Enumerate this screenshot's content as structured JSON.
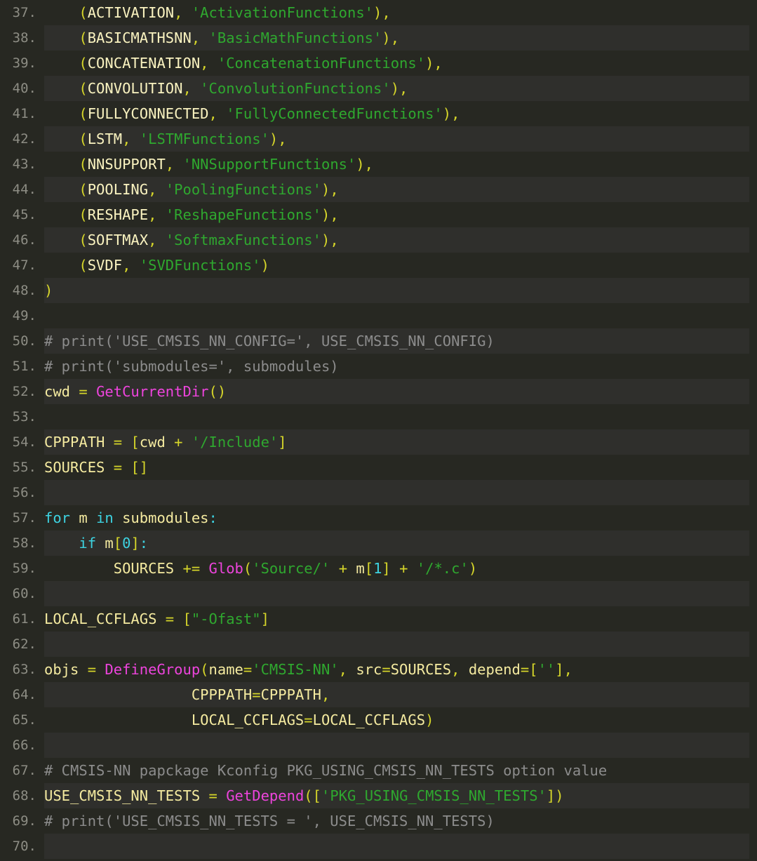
{
  "editor": {
    "name": "code-viewer",
    "language": "python",
    "background_color": "#272822",
    "alt_row_color": "#2f2f2c",
    "gutter_color": "#8d8d84",
    "first_line_number": 37,
    "last_line_number": 70,
    "colors": {
      "string": "#2fa82f",
      "comment": "#8c8c8c",
      "function": "#ee44dd",
      "keyword": "#3dd2e0",
      "number": "#3dd2e0",
      "identifier": "#f5eba0",
      "punctuation": "#d6d62a",
      "operator": "#d6d62a",
      "constant": "#faf3c0",
      "foreground": "#f8f8f2"
    }
  },
  "lines": [
    {
      "n": "37.",
      "alt": false,
      "tokens": [
        {
          "t": "    ",
          "c": "t-plain"
        },
        {
          "t": "(",
          "c": "t-punct"
        },
        {
          "t": "ACTIVATION",
          "c": "t-const"
        },
        {
          "t": ",",
          "c": "t-punct"
        },
        {
          "t": " ",
          "c": "t-plain"
        },
        {
          "t": "'ActivationFunctions'",
          "c": "t-string"
        },
        {
          "t": "),",
          "c": "t-punct"
        }
      ]
    },
    {
      "n": "38.",
      "alt": true,
      "tokens": [
        {
          "t": "    ",
          "c": "t-plain"
        },
        {
          "t": "(",
          "c": "t-punct"
        },
        {
          "t": "BASICMATHSNN",
          "c": "t-const"
        },
        {
          "t": ",",
          "c": "t-punct"
        },
        {
          "t": " ",
          "c": "t-plain"
        },
        {
          "t": "'BasicMathFunctions'",
          "c": "t-string"
        },
        {
          "t": "),",
          "c": "t-punct"
        }
      ]
    },
    {
      "n": "39.",
      "alt": false,
      "tokens": [
        {
          "t": "    ",
          "c": "t-plain"
        },
        {
          "t": "(",
          "c": "t-punct"
        },
        {
          "t": "CONCATENATION",
          "c": "t-const"
        },
        {
          "t": ",",
          "c": "t-punct"
        },
        {
          "t": " ",
          "c": "t-plain"
        },
        {
          "t": "'ConcatenationFunctions'",
          "c": "t-string"
        },
        {
          "t": "),",
          "c": "t-punct"
        }
      ]
    },
    {
      "n": "40.",
      "alt": true,
      "tokens": [
        {
          "t": "    ",
          "c": "t-plain"
        },
        {
          "t": "(",
          "c": "t-punct"
        },
        {
          "t": "CONVOLUTION",
          "c": "t-const"
        },
        {
          "t": ",",
          "c": "t-punct"
        },
        {
          "t": " ",
          "c": "t-plain"
        },
        {
          "t": "'ConvolutionFunctions'",
          "c": "t-string"
        },
        {
          "t": "),",
          "c": "t-punct"
        }
      ]
    },
    {
      "n": "41.",
      "alt": false,
      "tokens": [
        {
          "t": "    ",
          "c": "t-plain"
        },
        {
          "t": "(",
          "c": "t-punct"
        },
        {
          "t": "FULLYCONNECTED",
          "c": "t-const"
        },
        {
          "t": ",",
          "c": "t-punct"
        },
        {
          "t": " ",
          "c": "t-plain"
        },
        {
          "t": "'FullyConnectedFunctions'",
          "c": "t-string"
        },
        {
          "t": "),",
          "c": "t-punct"
        }
      ]
    },
    {
      "n": "42.",
      "alt": true,
      "tokens": [
        {
          "t": "    ",
          "c": "t-plain"
        },
        {
          "t": "(",
          "c": "t-punct"
        },
        {
          "t": "LSTM",
          "c": "t-const"
        },
        {
          "t": ",",
          "c": "t-punct"
        },
        {
          "t": " ",
          "c": "t-plain"
        },
        {
          "t": "'LSTMFunctions'",
          "c": "t-string"
        },
        {
          "t": "),",
          "c": "t-punct"
        }
      ]
    },
    {
      "n": "43.",
      "alt": false,
      "tokens": [
        {
          "t": "    ",
          "c": "t-plain"
        },
        {
          "t": "(",
          "c": "t-punct"
        },
        {
          "t": "NNSUPPORT",
          "c": "t-const"
        },
        {
          "t": ",",
          "c": "t-punct"
        },
        {
          "t": " ",
          "c": "t-plain"
        },
        {
          "t": "'NNSupportFunctions'",
          "c": "t-string"
        },
        {
          "t": "),",
          "c": "t-punct"
        }
      ]
    },
    {
      "n": "44.",
      "alt": true,
      "tokens": [
        {
          "t": "    ",
          "c": "t-plain"
        },
        {
          "t": "(",
          "c": "t-punct"
        },
        {
          "t": "POOLING",
          "c": "t-const"
        },
        {
          "t": ",",
          "c": "t-punct"
        },
        {
          "t": " ",
          "c": "t-plain"
        },
        {
          "t": "'PoolingFunctions'",
          "c": "t-string"
        },
        {
          "t": "),",
          "c": "t-punct"
        }
      ]
    },
    {
      "n": "45.",
      "alt": false,
      "tokens": [
        {
          "t": "    ",
          "c": "t-plain"
        },
        {
          "t": "(",
          "c": "t-punct"
        },
        {
          "t": "RESHAPE",
          "c": "t-const"
        },
        {
          "t": ",",
          "c": "t-punct"
        },
        {
          "t": " ",
          "c": "t-plain"
        },
        {
          "t": "'ReshapeFunctions'",
          "c": "t-string"
        },
        {
          "t": "),",
          "c": "t-punct"
        }
      ]
    },
    {
      "n": "46.",
      "alt": true,
      "tokens": [
        {
          "t": "    ",
          "c": "t-plain"
        },
        {
          "t": "(",
          "c": "t-punct"
        },
        {
          "t": "SOFTMAX",
          "c": "t-const"
        },
        {
          "t": ",",
          "c": "t-punct"
        },
        {
          "t": " ",
          "c": "t-plain"
        },
        {
          "t": "'SoftmaxFunctions'",
          "c": "t-string"
        },
        {
          "t": "),",
          "c": "t-punct"
        }
      ]
    },
    {
      "n": "47.",
      "alt": false,
      "tokens": [
        {
          "t": "    ",
          "c": "t-plain"
        },
        {
          "t": "(",
          "c": "t-punct"
        },
        {
          "t": "SVDF",
          "c": "t-const"
        },
        {
          "t": ",",
          "c": "t-punct"
        },
        {
          "t": " ",
          "c": "t-plain"
        },
        {
          "t": "'SVDFunctions'",
          "c": "t-string"
        },
        {
          "t": ")",
          "c": "t-punct"
        }
      ]
    },
    {
      "n": "48.",
      "alt": true,
      "tokens": [
        {
          "t": ")",
          "c": "t-punct"
        }
      ]
    },
    {
      "n": "49.",
      "alt": false,
      "tokens": []
    },
    {
      "n": "50.",
      "alt": true,
      "tokens": [
        {
          "t": "# print('USE_CMSIS_NN_CONFIG=', USE_CMSIS_NN_CONFIG)",
          "c": "t-comment"
        }
      ]
    },
    {
      "n": "51.",
      "alt": false,
      "tokens": [
        {
          "t": "# print('submodules=', submodules)",
          "c": "t-comment"
        }
      ]
    },
    {
      "n": "52.",
      "alt": true,
      "tokens": [
        {
          "t": "cwd",
          "c": "t-ident"
        },
        {
          "t": " ",
          "c": "t-plain"
        },
        {
          "t": "=",
          "c": "t-op"
        },
        {
          "t": " ",
          "c": "t-plain"
        },
        {
          "t": "GetCurrentDir",
          "c": "t-func"
        },
        {
          "t": "()",
          "c": "t-punct"
        }
      ]
    },
    {
      "n": "53.",
      "alt": false,
      "tokens": []
    },
    {
      "n": "54.",
      "alt": true,
      "tokens": [
        {
          "t": "CPPPATH",
          "c": "t-ident"
        },
        {
          "t": " ",
          "c": "t-plain"
        },
        {
          "t": "=",
          "c": "t-op"
        },
        {
          "t": " ",
          "c": "t-plain"
        },
        {
          "t": "[",
          "c": "t-punct"
        },
        {
          "t": "cwd",
          "c": "t-ident"
        },
        {
          "t": " ",
          "c": "t-plain"
        },
        {
          "t": "+",
          "c": "t-op"
        },
        {
          "t": " ",
          "c": "t-plain"
        },
        {
          "t": "'/Include'",
          "c": "t-string"
        },
        {
          "t": "]",
          "c": "t-punct"
        }
      ]
    },
    {
      "n": "55.",
      "alt": false,
      "tokens": [
        {
          "t": "SOURCES",
          "c": "t-ident"
        },
        {
          "t": " ",
          "c": "t-plain"
        },
        {
          "t": "=",
          "c": "t-op"
        },
        {
          "t": " ",
          "c": "t-plain"
        },
        {
          "t": "[]",
          "c": "t-punct"
        }
      ]
    },
    {
      "n": "56.",
      "alt": true,
      "tokens": []
    },
    {
      "n": "57.",
      "alt": false,
      "tokens": [
        {
          "t": "for",
          "c": "t-kw"
        },
        {
          "t": " ",
          "c": "t-plain"
        },
        {
          "t": "m",
          "c": "t-ident"
        },
        {
          "t": " ",
          "c": "t-plain"
        },
        {
          "t": "in",
          "c": "t-kw"
        },
        {
          "t": " ",
          "c": "t-plain"
        },
        {
          "t": "submodules",
          "c": "t-ident"
        },
        {
          "t": ":",
          "c": "t-colon"
        }
      ]
    },
    {
      "n": "58.",
      "alt": true,
      "tokens": [
        {
          "t": "    ",
          "c": "t-plain"
        },
        {
          "t": "if",
          "c": "t-kw"
        },
        {
          "t": " ",
          "c": "t-plain"
        },
        {
          "t": "m",
          "c": "t-ident"
        },
        {
          "t": "[",
          "c": "t-punct"
        },
        {
          "t": "0",
          "c": "t-num"
        },
        {
          "t": "]",
          "c": "t-punct"
        },
        {
          "t": ":",
          "c": "t-colon"
        }
      ]
    },
    {
      "n": "59.",
      "alt": false,
      "tokens": [
        {
          "t": "        ",
          "c": "t-plain"
        },
        {
          "t": "SOURCES",
          "c": "t-ident"
        },
        {
          "t": " ",
          "c": "t-plain"
        },
        {
          "t": "+=",
          "c": "t-op"
        },
        {
          "t": " ",
          "c": "t-plain"
        },
        {
          "t": "Glob",
          "c": "t-func"
        },
        {
          "t": "(",
          "c": "t-punct"
        },
        {
          "t": "'Source/'",
          "c": "t-string"
        },
        {
          "t": " ",
          "c": "t-plain"
        },
        {
          "t": "+",
          "c": "t-op"
        },
        {
          "t": " ",
          "c": "t-plain"
        },
        {
          "t": "m",
          "c": "t-ident"
        },
        {
          "t": "[",
          "c": "t-punct"
        },
        {
          "t": "1",
          "c": "t-num"
        },
        {
          "t": "]",
          "c": "t-punct"
        },
        {
          "t": " ",
          "c": "t-plain"
        },
        {
          "t": "+",
          "c": "t-op"
        },
        {
          "t": " ",
          "c": "t-plain"
        },
        {
          "t": "'/*.c'",
          "c": "t-string"
        },
        {
          "t": ")",
          "c": "t-punct"
        }
      ]
    },
    {
      "n": "60.",
      "alt": true,
      "tokens": []
    },
    {
      "n": "61.",
      "alt": false,
      "tokens": [
        {
          "t": "LOCAL_CCFLAGS",
          "c": "t-ident"
        },
        {
          "t": " ",
          "c": "t-plain"
        },
        {
          "t": "=",
          "c": "t-op"
        },
        {
          "t": " ",
          "c": "t-plain"
        },
        {
          "t": "[",
          "c": "t-punct"
        },
        {
          "t": "\"-Ofast\"",
          "c": "t-string"
        },
        {
          "t": "]",
          "c": "t-punct"
        }
      ]
    },
    {
      "n": "62.",
      "alt": true,
      "tokens": []
    },
    {
      "n": "63.",
      "alt": false,
      "tokens": [
        {
          "t": "objs",
          "c": "t-ident"
        },
        {
          "t": " ",
          "c": "t-plain"
        },
        {
          "t": "=",
          "c": "t-op"
        },
        {
          "t": " ",
          "c": "t-plain"
        },
        {
          "t": "DefineGroup",
          "c": "t-func"
        },
        {
          "t": "(",
          "c": "t-punct"
        },
        {
          "t": "name",
          "c": "t-ident"
        },
        {
          "t": "=",
          "c": "t-op"
        },
        {
          "t": "'CMSIS-NN'",
          "c": "t-string"
        },
        {
          "t": ",",
          "c": "t-punct"
        },
        {
          "t": " ",
          "c": "t-plain"
        },
        {
          "t": "src",
          "c": "t-ident"
        },
        {
          "t": "=",
          "c": "t-op"
        },
        {
          "t": "SOURCES",
          "c": "t-ident"
        },
        {
          "t": ",",
          "c": "t-punct"
        },
        {
          "t": " ",
          "c": "t-plain"
        },
        {
          "t": "depend",
          "c": "t-ident"
        },
        {
          "t": "=",
          "c": "t-op"
        },
        {
          "t": "[",
          "c": "t-punct"
        },
        {
          "t": "''",
          "c": "t-string"
        },
        {
          "t": "],",
          "c": "t-punct"
        }
      ]
    },
    {
      "n": "64.",
      "alt": true,
      "tokens": [
        {
          "t": "                 ",
          "c": "t-plain"
        },
        {
          "t": "CPPPATH",
          "c": "t-ident"
        },
        {
          "t": "=",
          "c": "t-op"
        },
        {
          "t": "CPPPATH",
          "c": "t-ident"
        },
        {
          "t": ",",
          "c": "t-punct"
        }
      ]
    },
    {
      "n": "65.",
      "alt": false,
      "tokens": [
        {
          "t": "                 ",
          "c": "t-plain"
        },
        {
          "t": "LOCAL_CCFLAGS",
          "c": "t-ident"
        },
        {
          "t": "=",
          "c": "t-op"
        },
        {
          "t": "LOCAL_CCFLAGS",
          "c": "t-ident"
        },
        {
          "t": ")",
          "c": "t-punct"
        }
      ]
    },
    {
      "n": "66.",
      "alt": true,
      "tokens": []
    },
    {
      "n": "67.",
      "alt": false,
      "tokens": [
        {
          "t": "# CMSIS-NN papckage Kconfig PKG_USING_CMSIS_NN_TESTS option value",
          "c": "t-comment"
        }
      ]
    },
    {
      "n": "68.",
      "alt": true,
      "tokens": [
        {
          "t": "USE_CMSIS_NN_TESTS",
          "c": "t-ident"
        },
        {
          "t": " ",
          "c": "t-plain"
        },
        {
          "t": "=",
          "c": "t-op"
        },
        {
          "t": " ",
          "c": "t-plain"
        },
        {
          "t": "GetDepend",
          "c": "t-func"
        },
        {
          "t": "([",
          "c": "t-punct"
        },
        {
          "t": "'PKG_USING_CMSIS_NN_TESTS'",
          "c": "t-string"
        },
        {
          "t": "])",
          "c": "t-punct"
        }
      ]
    },
    {
      "n": "69.",
      "alt": false,
      "tokens": [
        {
          "t": "# print('USE_CMSIS_NN_TESTS = ', USE_CMSIS_NN_TESTS)",
          "c": "t-comment"
        }
      ]
    },
    {
      "n": "70.",
      "alt": true,
      "tokens": []
    }
  ]
}
